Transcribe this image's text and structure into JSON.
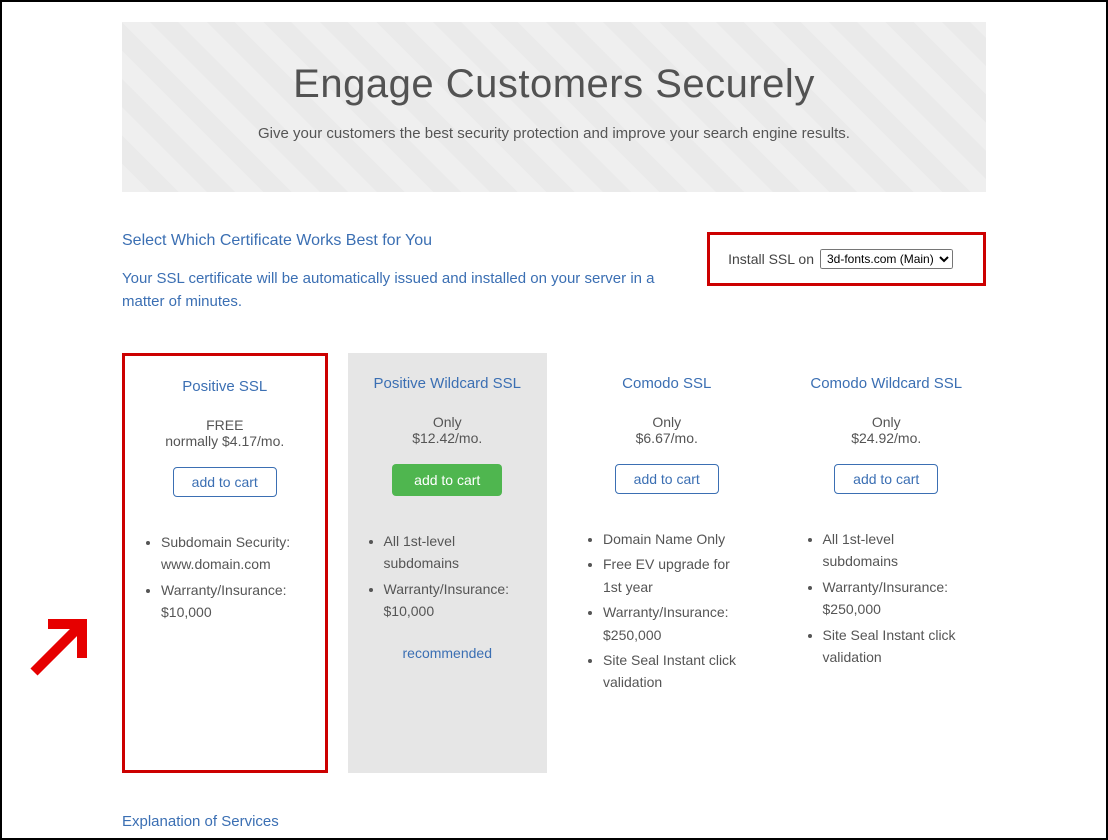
{
  "hero": {
    "title": "Engage Customers Securely",
    "subtitle": "Give your customers the best security protection and improve your search engine results."
  },
  "section": {
    "select_title": "Select Which Certificate Works Best for You",
    "desc": "Your SSL certificate will be automatically issued and installed on your server in a matter of minutes.",
    "install_label": "Install SSL on",
    "install_selected": "3d-fonts.com (Main)"
  },
  "cards": [
    {
      "title": "Positive SSL",
      "price_line1": "FREE",
      "price_line2": "normally $4.17/mo.",
      "button_label": "add to cart",
      "button_style": "outline",
      "features": [
        "Subdomain Security: www.domain.com",
        "Warranty/Insurance: $10,000"
      ],
      "recommended": ""
    },
    {
      "title": "Positive Wildcard SSL",
      "price_line1": "Only",
      "price_line2": "$12.42/mo.",
      "button_label": "add to cart",
      "button_style": "green",
      "features": [
        "All 1st-level subdomains",
        "Warranty/Insurance: $10,000"
      ],
      "recommended": "recommended"
    },
    {
      "title": "Comodo SSL",
      "price_line1": "Only",
      "price_line2": "$6.67/mo.",
      "button_label": "add to cart",
      "button_style": "outline",
      "features": [
        "Domain Name Only",
        "Free EV upgrade for 1st year",
        "Warranty/Insurance: $250,000",
        "Site Seal Instant click validation"
      ],
      "recommended": ""
    },
    {
      "title": "Comodo Wildcard SSL",
      "price_line1": "Only",
      "price_line2": "$24.92/mo.",
      "button_label": "add to cart",
      "button_style": "outline",
      "features": [
        "All 1st-level subdomains",
        "Warranty/Insurance: $250,000",
        "Site Seal Instant click validation"
      ],
      "recommended": ""
    }
  ],
  "footer_link": "Explanation of Services"
}
